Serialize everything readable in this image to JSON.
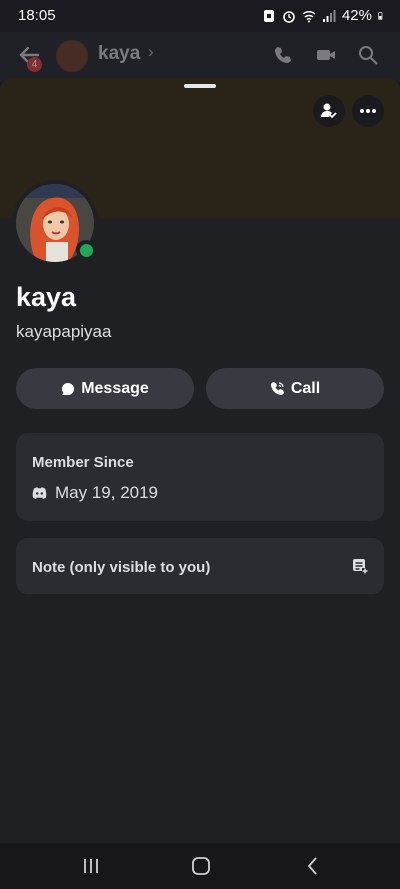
{
  "status_bar": {
    "time": "18:05",
    "battery": "42%"
  },
  "background_header": {
    "channel_name": "kaya",
    "unread_count": "4"
  },
  "profile": {
    "display_name": "kaya",
    "username": "kayapapiyaa",
    "status": "online"
  },
  "actions": {
    "message_label": "Message",
    "call_label": "Call"
  },
  "member_since": {
    "label": "Member Since",
    "date": "May 19, 2019"
  },
  "note": {
    "label": "Note (only visible to you)"
  },
  "colors": {
    "online": "#23a55a",
    "card": "#2b2c31",
    "button": "#393a41",
    "badge": "#d83c3e"
  }
}
